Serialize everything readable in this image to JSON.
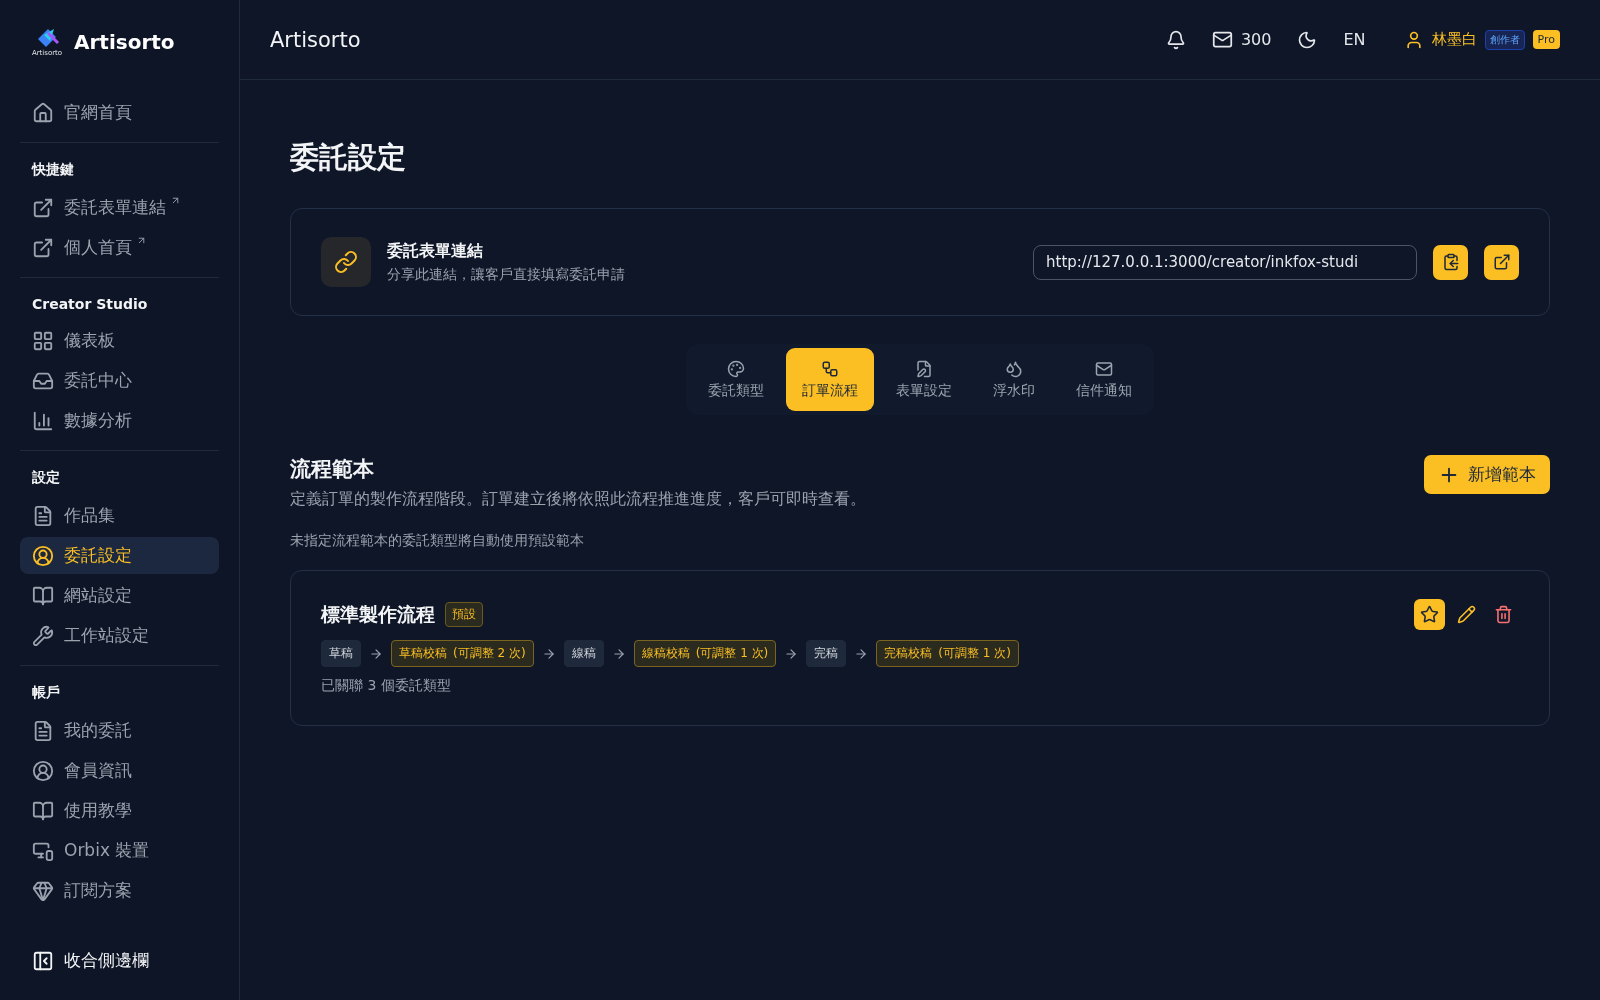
{
  "brand": {
    "name": "Artisorto",
    "logo_caption": "Artisorto"
  },
  "sidebar": {
    "home": {
      "label": "官網首頁",
      "selected": false
    },
    "sections": [
      {
        "heading": "快捷鍵",
        "items": [
          {
            "label": "委託表單連結",
            "external": true,
            "selected": false
          },
          {
            "label": "個人首頁",
            "external": true,
            "selected": false
          }
        ]
      },
      {
        "heading": "Creator Studio",
        "items": [
          {
            "label": "儀表板",
            "external": false,
            "selected": false
          },
          {
            "label": "委託中心",
            "external": false,
            "selected": false
          },
          {
            "label": "數據分析",
            "external": false,
            "selected": false
          }
        ]
      },
      {
        "heading": "設定",
        "items": [
          {
            "label": "作品集",
            "external": false,
            "selected": false
          },
          {
            "label": "委託設定",
            "external": false,
            "selected": true
          },
          {
            "label": "網站設定",
            "external": false,
            "selected": false
          },
          {
            "label": "工作站設定",
            "external": false,
            "selected": false
          }
        ]
      },
      {
        "heading": "帳戶",
        "items": [
          {
            "label": "我的委託",
            "external": false,
            "selected": false
          },
          {
            "label": "會員資訊",
            "external": false,
            "selected": false
          },
          {
            "label": "使用教學",
            "external": false,
            "selected": false
          },
          {
            "label": "Orbix 裝置",
            "external": false,
            "selected": false
          },
          {
            "label": "訂閱方案",
            "external": false,
            "selected": false
          }
        ]
      }
    ],
    "collapse": "收合側邊欄"
  },
  "header": {
    "title": "Artisorto",
    "mail_count": "300",
    "language": "EN",
    "user": "林墨白",
    "role_badge": "創作者",
    "plan_badge": "Pro"
  },
  "page_title": "委託設定",
  "link_card": {
    "title": "委託表單連結",
    "subtitle": "分享此連結，讓客戶直接填寫委託申請",
    "url": "http://127.0.0.1:3000/creator/inkfox-studi"
  },
  "tabs": [
    {
      "label": "委託類型",
      "selected": false
    },
    {
      "label": "訂單流程",
      "selected": true
    },
    {
      "label": "表單設定",
      "selected": false
    },
    {
      "label": "浮水印",
      "selected": false
    },
    {
      "label": "信件通知",
      "selected": false
    }
  ],
  "section": {
    "title": "流程範本",
    "description": "定義訂單的製作流程階段。訂單建立後將依照此流程推進進度，客戶可即時查看。",
    "add_button": "新增範本",
    "note": "未指定流程範本的委託類型將自動使用預設範本"
  },
  "templates": [
    {
      "name": "標準製作流程",
      "badge": "預設",
      "is_default": true,
      "linked": "已關聯 3 個委託類型",
      "stages": [
        {
          "kind": "stage",
          "name": "草稿"
        },
        {
          "kind": "review",
          "name": "草稿校稿",
          "limit": "(可調整 2 次)"
        },
        {
          "kind": "stage",
          "name": "線稿"
        },
        {
          "kind": "review",
          "name": "線稿校稿",
          "limit": "(可調整 1 次)"
        },
        {
          "kind": "stage",
          "name": "完稿"
        },
        {
          "kind": "review",
          "name": "完稿校稿",
          "limit": "(可調整 1 次)"
        }
      ]
    }
  ]
}
